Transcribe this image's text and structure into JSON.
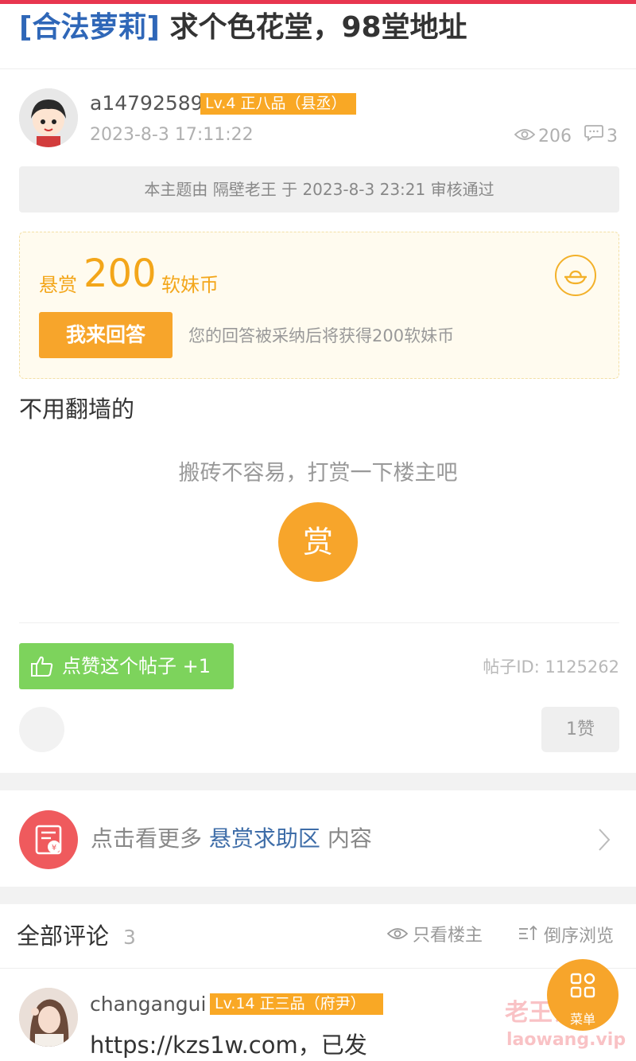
{
  "post": {
    "tag": "[合法萝莉]",
    "title": " 求个色花堂，98堂地址"
  },
  "author": {
    "username": "a14792589",
    "level": "Lv.4 正八品（县丞）",
    "date": "2023-8-3 17:11:22",
    "views": "206",
    "replies": "3"
  },
  "review_notice": "本主题由 隔壁老王 于 2023-8-3 23:21 审核通过",
  "bounty": {
    "label": "悬赏",
    "amount": "200",
    "unit": "软妹币",
    "answer_button": "我来回答",
    "hint": "您的回答被采纳后将获得200软妹币"
  },
  "body_text": "不用翻墙的",
  "reward": {
    "tip": "搬砖不容易，打赏一下楼主吧",
    "button": "赏"
  },
  "like": {
    "button": "点赞这个帖子 +1",
    "post_id": "帖子ID: 1125262",
    "count": "1赞"
  },
  "more": {
    "prefix": "点击看更多 ",
    "link": "悬赏求助区",
    "suffix": " 内容"
  },
  "comments": {
    "title": "全部评论",
    "count": "3",
    "only_op": "只看楼主",
    "reverse": "倒序浏览",
    "items": [
      {
        "username": "changangui",
        "level": "Lv.14 正三品（府尹）",
        "text": "https://kzs1w.com，已发"
      }
    ]
  },
  "fab": {
    "label": "菜单"
  },
  "watermark": {
    "title": "老王论坛",
    "url": "laowang.vip"
  },
  "colors": {
    "accent_red": "#e8364f",
    "tag_blue": "#2f67b8",
    "orange": "#f7a52b",
    "green": "#7dd35c"
  }
}
